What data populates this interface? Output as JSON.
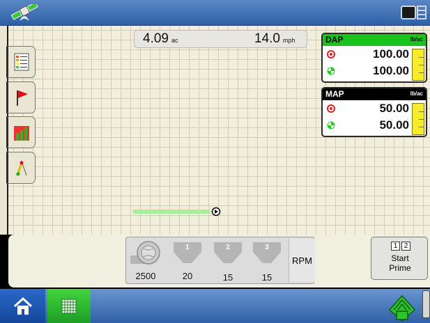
{
  "icons": {
    "gps": "gps-satellite-icon",
    "screen": "screen-toggle-icon",
    "sidebar": [
      "legend-list-icon",
      "flag-icon",
      "chart-icon",
      "guidance-icon"
    ],
    "home": "home-icon",
    "grid": "grid-icon",
    "field": "field-ops-icon"
  },
  "readout": {
    "area_value": "4.09",
    "area_unit": "ac",
    "speed_value": "14.0",
    "speed_unit": "mph"
  },
  "products": [
    {
      "name": "DAP",
      "unit": "lb/ac",
      "header_color": "#19c31d",
      "target_rate": "100.00",
      "actual_rate": "100.00"
    },
    {
      "name": "MAP",
      "unit": "lb/ac",
      "header_color": "#000000",
      "target_rate": "50.00",
      "actual_rate": "50.00"
    }
  ],
  "meters": {
    "fan_value": "2500",
    "rows": [
      {
        "label": "1",
        "value": "20"
      },
      {
        "label": "2",
        "value": "15"
      },
      {
        "label": "3",
        "value": "15"
      }
    ],
    "rpm_label": "RPM"
  },
  "prime": {
    "sections": [
      "1",
      "2"
    ],
    "label_line1": "Start",
    "label_line2": "Prime"
  },
  "colors": {
    "map_background": "#f1efdc",
    "swath": "#a6ef9c",
    "hopper_gray": "#b5b5b5",
    "rate_bar_yellow": "#f6ec2a"
  }
}
